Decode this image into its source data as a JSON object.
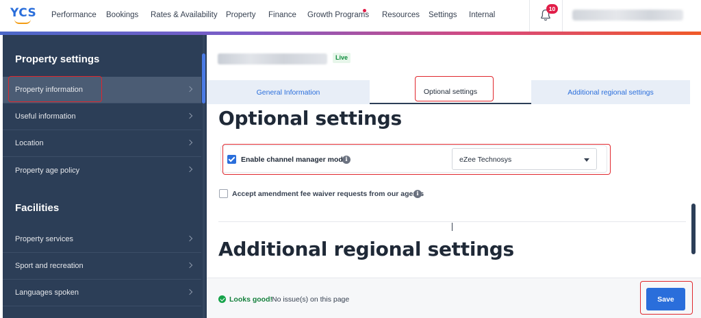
{
  "app": {
    "logo": "YCS"
  },
  "nav": {
    "items": [
      "Performance",
      "Bookings",
      "Rates & Availability",
      "Property",
      "Finance",
      "Growth Programs",
      "Resources",
      "Settings",
      "Internal"
    ],
    "notifications_count": "10"
  },
  "sidebar": {
    "section1_title": "Property settings",
    "section1_items": [
      {
        "label": "Property information",
        "active": true
      },
      {
        "label": "Useful information",
        "active": false
      },
      {
        "label": "Location",
        "active": false
      },
      {
        "label": "Property age policy",
        "active": false
      }
    ],
    "section2_title": "Facilities",
    "section2_items": [
      {
        "label": "Property services"
      },
      {
        "label": "Sport and recreation"
      },
      {
        "label": "Languages spoken"
      }
    ]
  },
  "property": {
    "status": "Live"
  },
  "tabs": [
    {
      "label": "General Information",
      "active": false
    },
    {
      "label": "Optional settings",
      "active": true
    },
    {
      "label": "Additional regional settings",
      "active": false
    }
  ],
  "optional": {
    "heading": "Optional settings",
    "channel_manager_label": "Enable channel manager mode",
    "channel_manager_checked": true,
    "channel_manager_value": "eZee Technosys",
    "amendment_label": "Accept amendment fee waiver requests from our agents",
    "amendment_checked": false,
    "info_glyph": "i"
  },
  "regional": {
    "heading": "Additional regional settings"
  },
  "footer": {
    "status_strong": "Looks good!",
    "status_text": "No issue(s) on this page",
    "save_label": "Save"
  },
  "colors": {
    "brand_blue": "#2a6edb",
    "sidebar_bg": "#2c3e57",
    "highlight_red": "#e0262c",
    "success_green": "#15803d"
  }
}
